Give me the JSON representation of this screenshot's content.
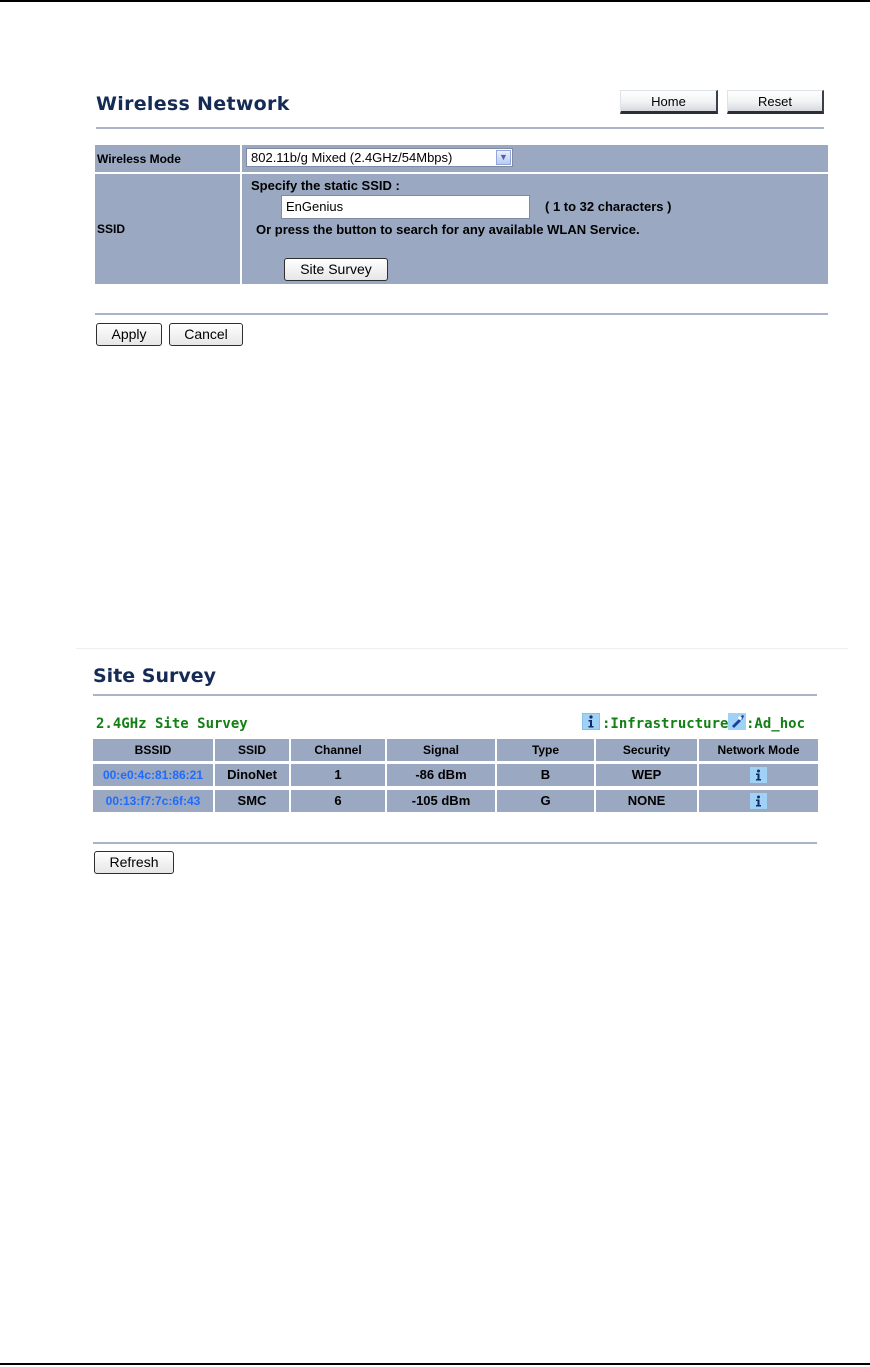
{
  "wireless_network": {
    "title": "Wireless Network",
    "home_label": "Home",
    "reset_label": "Reset",
    "mode_label": "Wireless Mode",
    "mode_value": "802.11b/g Mixed (2.4GHz/54Mbps)",
    "ssid_label": "SSID",
    "ssid_specify": "Specify the static SSID  :",
    "ssid_value": "EnGenius",
    "ssid_range": "( 1 to 32 characters )",
    "ssid_hint": "Or press the button to search for any available WLAN Service.",
    "site_survey_label": "Site Survey",
    "apply_label": "Apply",
    "cancel_label": "Cancel"
  },
  "site_survey": {
    "title": "Site Survey",
    "subtitle": "2.4GHz Site Survey",
    "legend_infrastructure": ":Infrastructure",
    "legend_adhoc": ":Ad_hoc",
    "columns": [
      "BSSID",
      "SSID",
      "Channel",
      "Signal",
      "Type",
      "Security",
      "Network Mode"
    ],
    "rows": [
      {
        "bssid": "00:e0:4c:81:86:21",
        "ssid": "DinoNet",
        "channel": "1",
        "signal": "-86 dBm",
        "type": "B",
        "security": "WEP",
        "network_mode": "infrastructure-icon"
      },
      {
        "bssid": "00:13:f7:7c:6f:43",
        "ssid": "SMC",
        "channel": "6",
        "signal": "-105 dBm",
        "type": "G",
        "security": "NONE",
        "network_mode": "infrastructure-icon"
      }
    ],
    "refresh_label": "Refresh"
  },
  "colors": {
    "title": "#152a55",
    "table_cell": "#9aa8c1",
    "survey_green": "#138013",
    "bssid_link": "#1e6bff"
  }
}
